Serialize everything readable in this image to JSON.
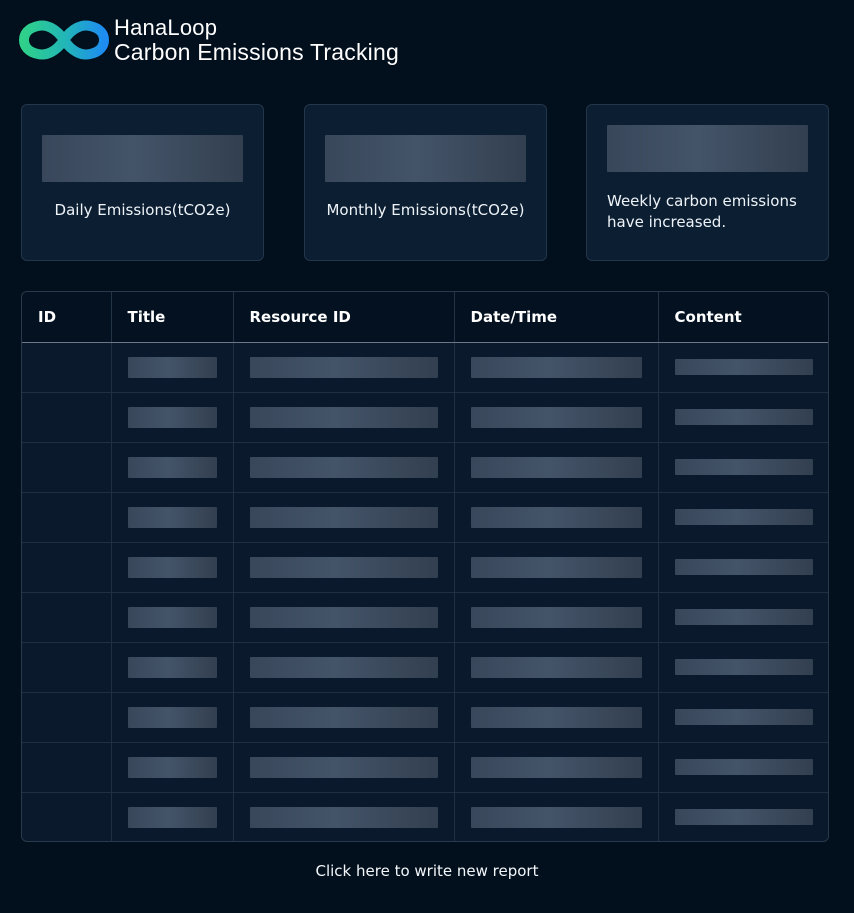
{
  "header": {
    "brand_name": "HanaLoop",
    "app_title": "Carbon Emissions Tracking"
  },
  "cards": [
    {
      "label": "Daily Emissions(tCO2e)"
    },
    {
      "label": "Monthly Emissions(tCO2e)"
    },
    {
      "label": "Weekly carbon emissions have increased."
    }
  ],
  "table": {
    "columns": [
      "ID",
      "Title",
      "Resource ID",
      "Date/Time",
      "Content"
    ],
    "row_count": 10
  },
  "footer": {
    "new_report_link": "Click here to write new report"
  },
  "colors": {
    "background": "#020f1c",
    "card": "#0c1e31",
    "skeleton": "#3d4a5c",
    "logo_green": "#2fd08a",
    "logo_blue": "#1e8cf0"
  },
  "icons": {
    "logo": "infinity-logo-icon"
  }
}
